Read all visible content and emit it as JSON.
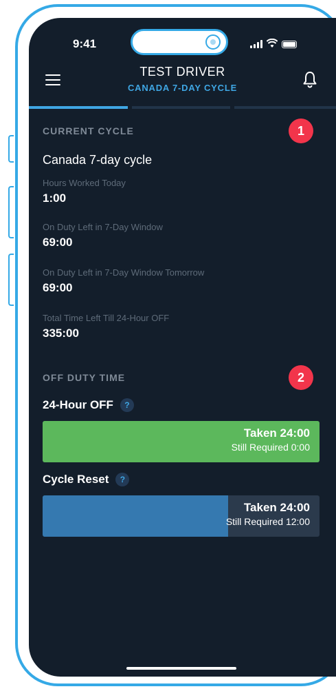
{
  "status": {
    "time": "9:41"
  },
  "header": {
    "driver_name": "TEST DRIVER",
    "cycle_subtitle": "CANADA 7-DAY CYCLE"
  },
  "tabs": [
    {
      "active": true
    },
    {
      "active": false
    },
    {
      "active": false
    }
  ],
  "current_cycle": {
    "section_title": "CURRENT CYCLE",
    "badge": "1",
    "cycle_name": "Canada 7-day cycle",
    "metrics": [
      {
        "label": "Hours Worked Today",
        "value": "1:00"
      },
      {
        "label": "On Duty Left in 7-Day Window",
        "value": "69:00"
      },
      {
        "label": "On Duty Left in 7-Day Window Tomorrow",
        "value": "69:00"
      },
      {
        "label": "Total Time Left Till 24-Hour OFF",
        "value": "335:00"
      }
    ]
  },
  "off_duty": {
    "section_title": "OFF DUTY TIME",
    "badge": "2",
    "help_glyph": "?",
    "items": [
      {
        "title": "24-Hour OFF",
        "taken": "Taken 24:00",
        "required": "Still Required 0:00",
        "progress": 1.0,
        "fill_color": "#5cb85c"
      },
      {
        "title": "Cycle Reset",
        "taken": "Taken 24:00",
        "required": "Still Required 12:00",
        "progress": 0.67,
        "fill_color": "#3579b0"
      }
    ]
  },
  "colors": {
    "accent": "#3fa6e3",
    "background": "#131e2b",
    "badge": "#f2354b",
    "frame": "#35a9e6"
  }
}
